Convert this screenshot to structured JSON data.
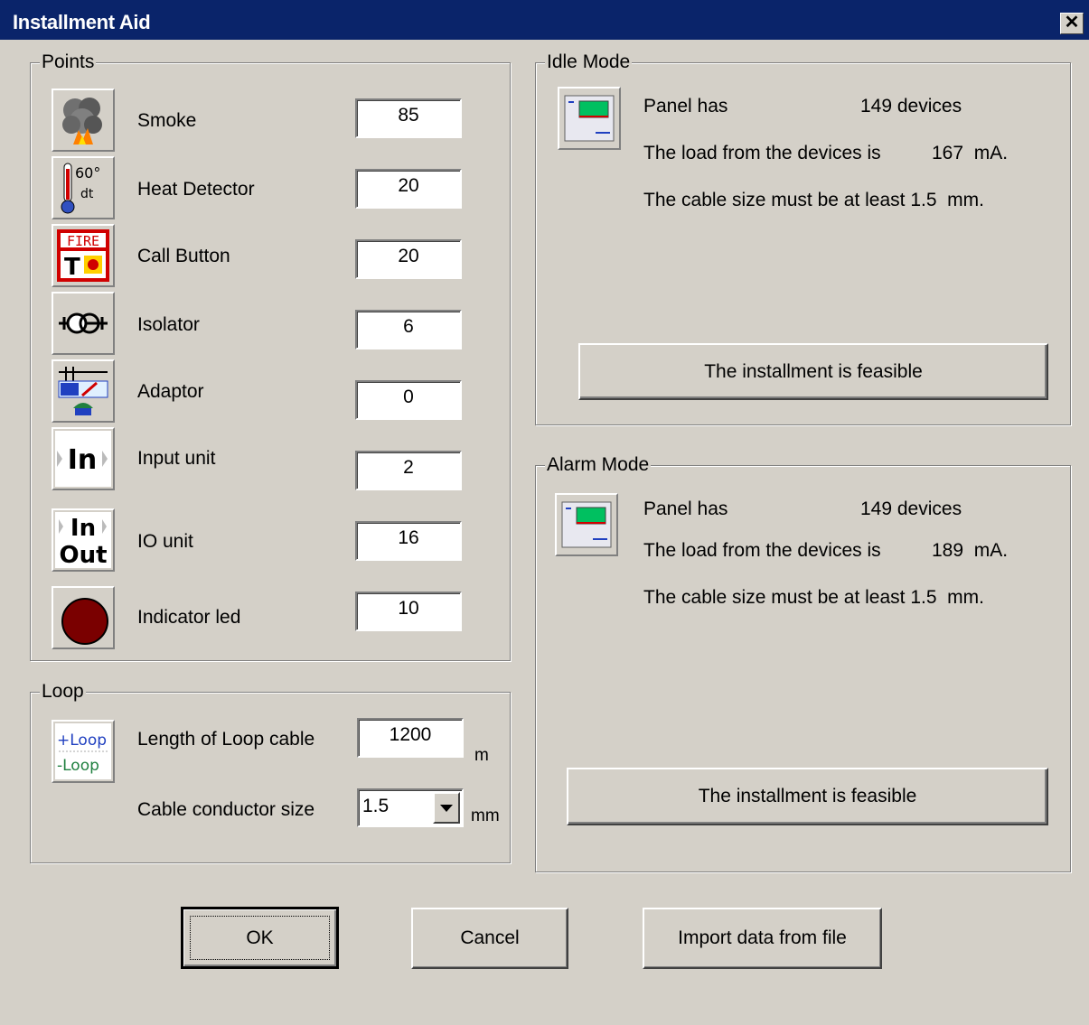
{
  "window": {
    "title": "Installment Aid",
    "close_glyph": "✕"
  },
  "points": {
    "legend": "Points",
    "items": [
      {
        "icon": "smoke-detector-icon",
        "label": "Smoke",
        "value": "85"
      },
      {
        "icon": "heat-detector-icon",
        "label": "Heat Detector",
        "value": "20"
      },
      {
        "icon": "fire-call-button-icon",
        "label": "Call Button",
        "value": "20"
      },
      {
        "icon": "isolator-icon",
        "label": "Isolator",
        "value": "6"
      },
      {
        "icon": "adaptor-icon",
        "label": "Adaptor",
        "value": "0"
      },
      {
        "icon": "input-unit-icon",
        "label": "Input unit",
        "value": "2"
      },
      {
        "icon": "io-unit-icon",
        "label": "IO unit",
        "value": "16"
      },
      {
        "icon": "indicator-led-icon",
        "label": "Indicator led",
        "value": "10"
      }
    ],
    "icon_text": {
      "heat_temp": "60°",
      "heat_dt": "dt",
      "fire": "FIRE",
      "t": "T",
      "in": "In",
      "out": "Out"
    }
  },
  "loop": {
    "legend": "Loop",
    "icon_plus": "+Loop",
    "icon_minus": "-Loop",
    "length_label": "Length of Loop cable",
    "length_value": "1200",
    "length_unit": "m",
    "conductor_label": "Cable conductor size",
    "conductor_value": "1.5",
    "conductor_unit": "mm"
  },
  "idle_mode": {
    "legend": "Idle Mode",
    "panel_label": "Panel has",
    "devices": "149 devices",
    "load_label": "The load from the devices is",
    "load_value": "167  mA.",
    "cable_text": "The cable size must be at least 1.5  mm.",
    "status": "The installment is feasible"
  },
  "alarm_mode": {
    "legend": "Alarm Mode",
    "panel_label": "Panel has",
    "devices": "149 devices",
    "load_label": "The load from the devices is",
    "load_value": "189  mA.",
    "cable_text": "The cable size must be at least 1.5  mm.",
    "status": "The installment is feasible"
  },
  "buttons": {
    "ok": "OK",
    "cancel": "Cancel",
    "import": "Import data from file"
  },
  "colors": {
    "titlebar": "#0a246a",
    "face": "#d4d0c8",
    "led": "#7a0000",
    "panel_green": "#00c060"
  }
}
